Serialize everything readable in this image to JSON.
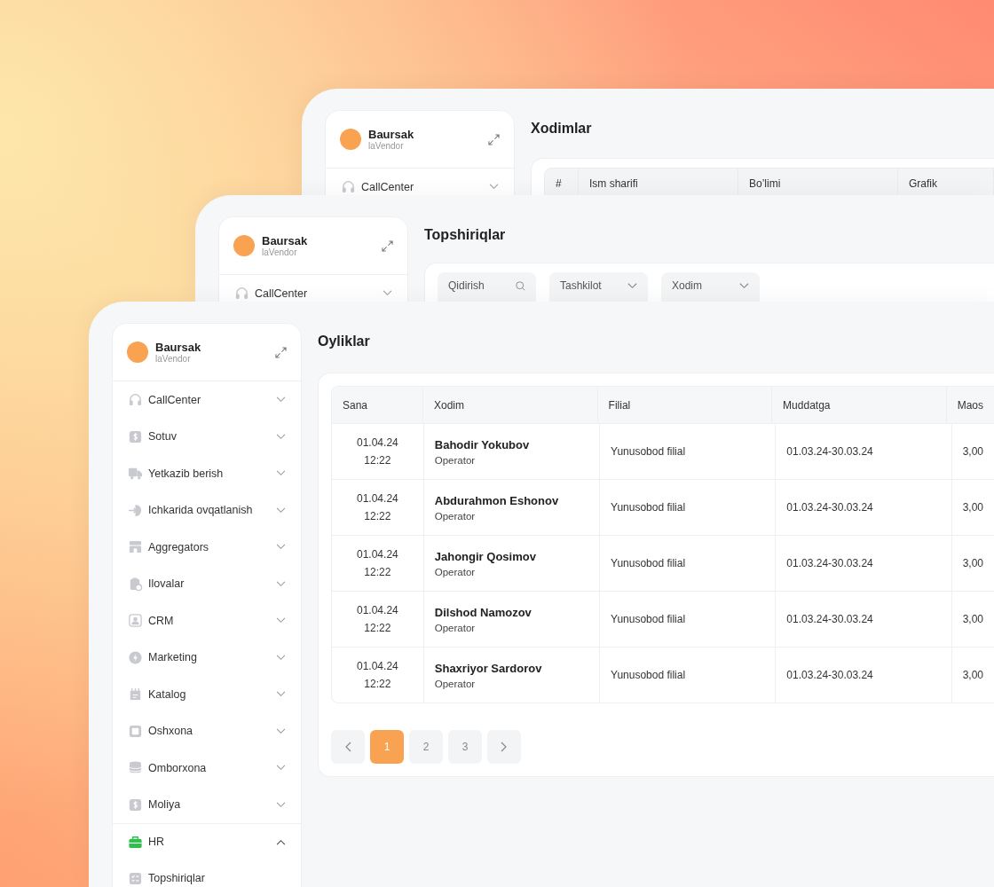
{
  "windows": [
    {
      "kind": "table",
      "title": "Xodimlar",
      "sidebar": {
        "brand": "Baursak",
        "subtitle": "laVendor",
        "items": [
          {
            "label": "CallCenter",
            "expanded": false,
            "selected": false
          }
        ]
      },
      "columns": [
        "#",
        "Ism sharifi",
        "Bo’limi",
        "Grafik"
      ]
    },
    {
      "kind": "filters",
      "title": "Topshiriqlar",
      "sidebar": {
        "brand": "Baursak",
        "subtitle": "laVendor",
        "items": [
          {
            "label": "CallCenter",
            "expanded": false,
            "selected": false
          }
        ]
      },
      "filters": [
        {
          "kind": "search",
          "placeholder": "Qidirish"
        },
        {
          "kind": "select",
          "placeholder": "Tashkilot"
        },
        {
          "kind": "select",
          "placeholder": "Xodim"
        }
      ]
    },
    {
      "kind": "payroll",
      "title": "Oyliklar",
      "sidebar": {
        "brand": "Baursak",
        "subtitle": "laVendor",
        "items": [
          {
            "label": "CallCenter",
            "expanded": false,
            "selected": false
          },
          {
            "label": "Sotuv",
            "expanded": false,
            "selected": false
          },
          {
            "label": "Yetkazib berish",
            "expanded": false,
            "selected": false
          },
          {
            "label": "Ichkarida ovqatlanish",
            "expanded": false,
            "selected": false
          },
          {
            "label": "Aggregators",
            "expanded": false,
            "selected": false
          },
          {
            "label": "Ilovalar",
            "expanded": false,
            "selected": false
          },
          {
            "label": "CRM",
            "expanded": false,
            "selected": false
          },
          {
            "label": "Marketing",
            "expanded": false,
            "selected": false
          },
          {
            "label": "Katalog",
            "expanded": false,
            "selected": false
          },
          {
            "label": "Oshxona",
            "expanded": false,
            "selected": false
          },
          {
            "label": "Omborxona",
            "expanded": false,
            "selected": false
          },
          {
            "label": "Moliya",
            "expanded": false,
            "selected": false
          },
          {
            "label": "HR",
            "expanded": true,
            "selected": true,
            "children": [
              {
                "label": "Topshiriqlar"
              }
            ]
          }
        ]
      },
      "columns": [
        "Sana",
        "Xodim",
        "Filial",
        "Muddatga",
        "Maos"
      ],
      "rows": [
        {
          "date": "01.04.24",
          "time": "12:22",
          "name": "Bahodir Yokubov",
          "role": "Operator",
          "branch": "Yunusobod filial",
          "period": "01.03.24-30.03.24",
          "salary": "3,00"
        },
        {
          "date": "01.04.24",
          "time": "12:22",
          "name": "Abdurahmon Eshonov",
          "role": "Operator",
          "branch": "Yunusobod filial",
          "period": "01.03.24-30.03.24",
          "salary": "3,00"
        },
        {
          "date": "01.04.24",
          "time": "12:22",
          "name": "Jahongir Qosimov",
          "role": "Operator",
          "branch": "Yunusobod filial",
          "period": "01.03.24-30.03.24",
          "salary": "3,00"
        },
        {
          "date": "01.04.24",
          "time": "12:22",
          "name": "Dilshod Namozov",
          "role": "Operator",
          "branch": "Yunusobod filial",
          "period": "01.03.24-30.03.24",
          "salary": "3,00"
        },
        {
          "date": "01.04.24",
          "time": "12:22",
          "name": "Shaxriyor Sardorov",
          "role": "Operator",
          "branch": "Yunusobod filial",
          "period": "01.03.24-30.03.24",
          "salary": "3,00"
        }
      ],
      "pagination": {
        "pages": [
          {
            "label": "1",
            "selected": true
          },
          {
            "label": "2",
            "selected": false
          },
          {
            "label": "3",
            "selected": false
          }
        ]
      }
    }
  ]
}
